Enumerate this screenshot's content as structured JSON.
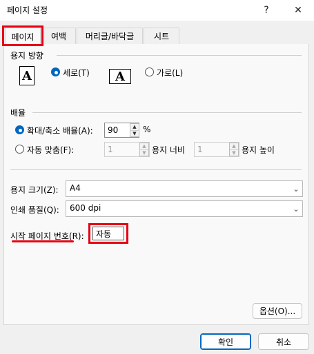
{
  "window": {
    "title": "페이지 설정",
    "help_glyph": "?",
    "close_glyph": "✕"
  },
  "tabs": [
    {
      "label": "페이지",
      "active": true
    },
    {
      "label": "여백"
    },
    {
      "label": "머리글/바닥글"
    },
    {
      "label": "시트"
    }
  ],
  "orientation": {
    "section_label": "용지 방향",
    "portrait_label": "세로(T)",
    "portrait_selected": true,
    "landscape_label": "가로(L)",
    "icon_letter": "A"
  },
  "scaling": {
    "section_label": "배율",
    "adjust_label": "확대/축소 배율(A):",
    "adjust_selected": true,
    "adjust_value": "90",
    "adjust_unit": "%",
    "fit_label": "자동 맞춤(F):",
    "fit_wide_value": "1",
    "fit_wide_label": "용지 너비",
    "fit_tall_value": "1",
    "fit_tall_label": "용지 높이"
  },
  "paper_size": {
    "label": "용지 크기(Z):",
    "value": "A4"
  },
  "print_quality": {
    "label": "인쇄 품질(Q):",
    "value": "600 dpi"
  },
  "first_page_number": {
    "label": "시작 페이지 번호(R):",
    "value": "자동"
  },
  "buttons": {
    "options": "옵션(O)...",
    "ok": "확인",
    "cancel": "취소"
  },
  "colors": {
    "accent": "#0067c0",
    "highlight": "#e60012"
  }
}
